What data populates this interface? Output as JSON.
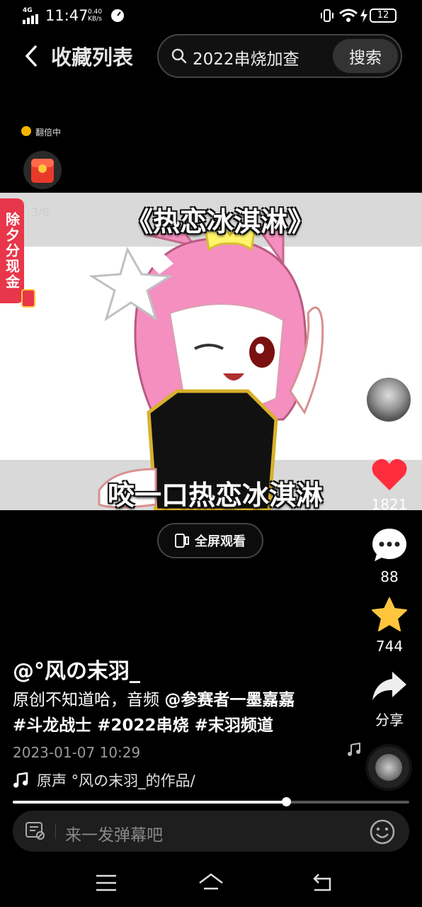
{
  "status_bar": {
    "network": "4G",
    "time": "11:47",
    "speed_value": "0.40",
    "speed_unit": "KB/s",
    "battery": "12"
  },
  "header": {
    "title": "收藏列表",
    "search_query": "2022串烧加查",
    "search_button": "搜索"
  },
  "promo": {
    "label": "翻倍中",
    "count": "3/6",
    "side_tab": "除夕分现金"
  },
  "video": {
    "subtitle_top": "《热恋冰淇淋》",
    "subtitle_bottom": "咬一口热恋冰淇淋"
  },
  "actions": {
    "likes": "1821",
    "comments": "88",
    "favorites": "744",
    "share": "分享"
  },
  "fullscreen_label": "全屏观看",
  "post": {
    "author": "@°风の末羽_",
    "desc_plain": "原创不知道哈，音频 ",
    "mention": "@参赛者一墨嘉嘉",
    "tags": "#斗龙战士 #2022串烧 #末羽频道",
    "date": "2023-01-07 10:29",
    "music": "原声    °风の末羽_的作品/"
  },
  "playback": {
    "progress": 0.69
  },
  "comment_placeholder": "来一发弹幕吧",
  "colors": {
    "like": "#ff2d3d",
    "star": "#ffc53d",
    "side_tab": "#e8364a"
  }
}
